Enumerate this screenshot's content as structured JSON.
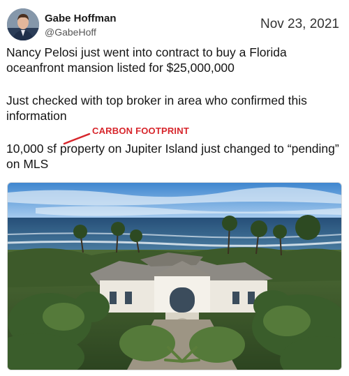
{
  "author": {
    "name": "Gabe Hoffman",
    "handle": "@GabeHoff",
    "avatar_icon": "person-avatar"
  },
  "tweet": {
    "date": "Nov 23, 2021",
    "paragraph1": "Nancy Pelosi just went into contract to buy a Florida oceanfront mansion listed for $25,000,000",
    "paragraph2": "Just checked with top broker in area who confirmed this information",
    "paragraph3": "10,000 sf property on Jupiter Island just changed to “pending” on MLS"
  },
  "annotation": {
    "text": "CARBON FOOTPRINT",
    "color": "#d7262c"
  },
  "photo": {
    "subject": "aerial view of oceanfront mansion with palm trees",
    "sky_color": "#5fa3dc",
    "ocean_color": "#2f5f88",
    "roof_color": "#8d8a84"
  }
}
